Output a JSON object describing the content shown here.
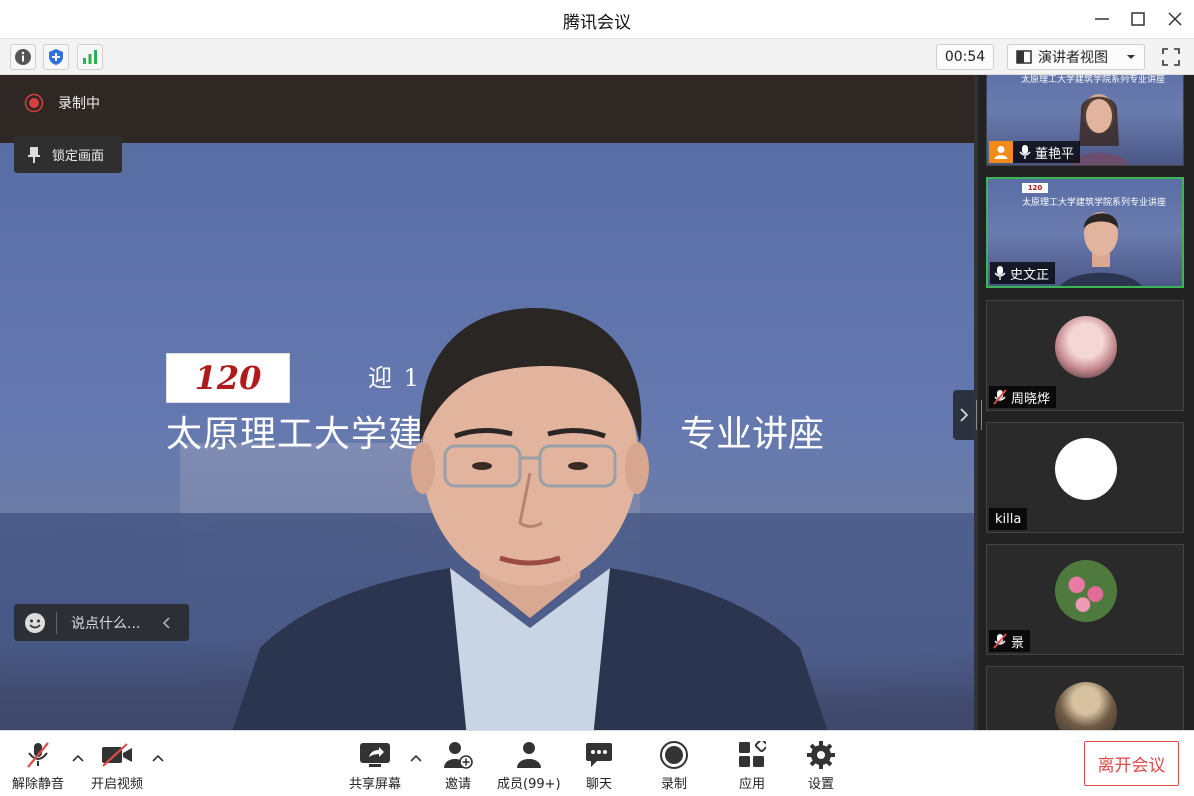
{
  "window": {
    "title": "腾讯会议"
  },
  "infobar": {
    "timer": "00:54",
    "view_mode": "演讲者视图"
  },
  "stage": {
    "recording_label": "录制中",
    "lock_view_label": "锁定画面",
    "chat_placeholder": "说点什么...",
    "slide": {
      "logo_text": "120",
      "line1": "迎 1",
      "line2_left": "太原理工大学建",
      "line2_right": "专业讲座"
    }
  },
  "participants": [
    {
      "name": "董艳平",
      "mic": "on",
      "host_badge": true,
      "video": "on"
    },
    {
      "name": "史文正",
      "mic": "on",
      "host_badge": false,
      "video": "on",
      "speaking": true
    },
    {
      "name": "周晓烨",
      "mic": "muted",
      "host_badge": false,
      "video": "off"
    },
    {
      "name": "killa",
      "mic": "none",
      "host_badge": false,
      "video": "off"
    },
    {
      "name": "景",
      "mic": "muted",
      "host_badge": false,
      "video": "off"
    },
    {
      "name": "",
      "mic": "none",
      "host_badge": false,
      "video": "off"
    }
  ],
  "tiles_slide_text": "太原理工大学建筑学院系列专业讲座",
  "toolbar": {
    "unmute": "解除静音",
    "start_video": "开启视频",
    "share_screen": "共享屏幕",
    "invite": "邀请",
    "members": "成员(99+)",
    "chat": "聊天",
    "record": "录制",
    "apps": "应用",
    "settings": "设置",
    "leave": "离开会议"
  },
  "colors": {
    "accent_green": "#3bb453",
    "leave_red": "#e04b4b",
    "badge_orange": "#f28b1a"
  }
}
